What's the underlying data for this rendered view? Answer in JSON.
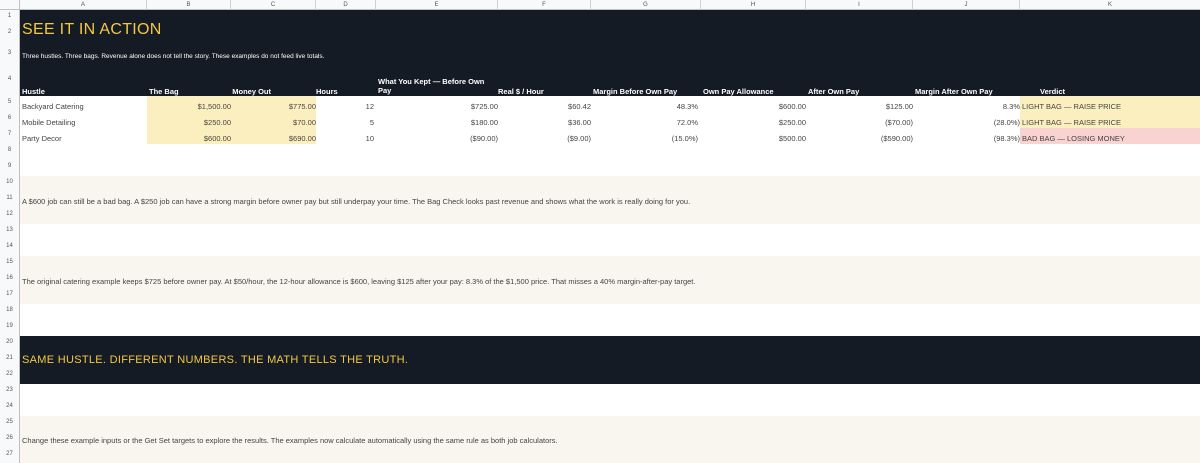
{
  "columns": [
    "A",
    "B",
    "C",
    "D",
    "E",
    "F",
    "G",
    "H",
    "I",
    "J",
    "K"
  ],
  "rows": [
    "1",
    "2",
    "3",
    "4",
    "5",
    "6",
    "7",
    "8",
    "9",
    "10",
    "11",
    "12",
    "13",
    "14",
    "15",
    "16",
    "17",
    "18",
    "19",
    "20",
    "21",
    "22",
    "23",
    "24",
    "25",
    "26",
    "27"
  ],
  "title": "SEE IT IN ACTION",
  "subtitle": "Three hustles. Three bags. Revenue alone does not tell the story. These examples do not feed live totals.",
  "table": {
    "headers": [
      "Hustle",
      "The Bag",
      "Money Out",
      "Hours",
      "What You Kept — Before Own Pay",
      "Real $ / Hour",
      "Margin Before Own Pay",
      "Own Pay Allowance",
      "After Own Pay",
      "Margin After Own Pay",
      "Verdict"
    ],
    "rows": [
      {
        "hustle": "Backyard Catering",
        "bag": "$1,500.00",
        "money_out": "$775.00",
        "hours": "12",
        "kept": "$725.00",
        "real_hour": "$60.42",
        "margin_before": "48.3%",
        "allowance": "$600.00",
        "after_pay": "$125.00",
        "margin_after": "8.3%",
        "verdict": "LIGHT BAG — RAISE PRICE"
      },
      {
        "hustle": "Mobile Detailing",
        "bag": "$250.00",
        "money_out": "$70.00",
        "hours": "5",
        "kept": "$180.00",
        "real_hour": "$36.00",
        "margin_before": "72.0%",
        "allowance": "$250.00",
        "after_pay": "($70.00)",
        "margin_after": "(28.0%)",
        "verdict": "LIGHT BAG — RAISE PRICE"
      },
      {
        "hustle": "Party Decor",
        "bag": "$600.00",
        "money_out": "$690.00",
        "hours": "10",
        "kept": "($90.00)",
        "real_hour": "($9.00)",
        "margin_before": "(15.0%)",
        "allowance": "$500.00",
        "after_pay": "($590.00)",
        "margin_after": "(98.3%)",
        "verdict": "BAD BAG — LOSING MONEY"
      }
    ]
  },
  "note1": "A $600 job can still be a bad bag. A $250 job can have a strong margin before owner pay but still underpay your time. The Bag Check looks past revenue and shows what the work is really doing for you.",
  "note2": "The original catering example keeps $725 before owner pay. At $50/hour, the 12-hour allowance is $600, leaving $125 after your pay: 8.3% of the $1,500 price. That misses a 40% margin-after-pay target.",
  "section2_title": "SAME HUSTLE. DIFFERENT NUMBERS. THE MATH TELLS THE TRUTH.",
  "note3": "Change these example inputs or the Get Set targets to explore the results. The examples now calculate automatically using the same rule as both job calculators.",
  "colors": {
    "dark": "#141b24",
    "gold": "#f5c842",
    "yellow": "#fcefbf",
    "pink": "#f8d3d1",
    "cream": "#f9f6ef"
  }
}
